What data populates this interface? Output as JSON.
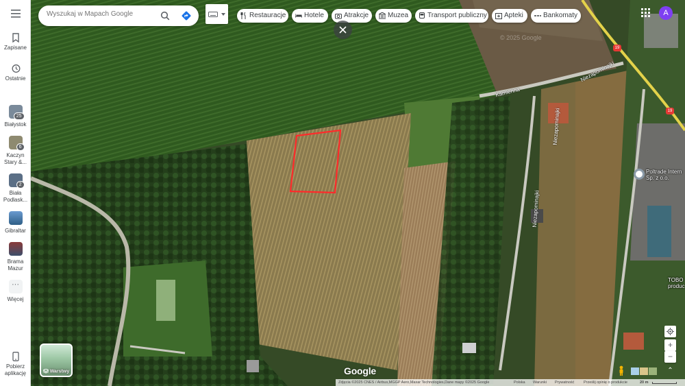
{
  "rail": {
    "saved_label": "Zapisane",
    "recent_label": "Ostatnie",
    "recent_items": [
      {
        "label": "Białystok",
        "badge": "25"
      },
      {
        "label": "Kaczyn Stary &...",
        "badge": "6"
      },
      {
        "label": "Biała Podlask...",
        "badge": "2"
      },
      {
        "label": "Gibraltar",
        "badge": ""
      },
      {
        "label": "Brama Mazur",
        "badge": ""
      }
    ],
    "more_label": "Więcej",
    "download_label": "Pobierz aplikację"
  },
  "search": {
    "placeholder": "Wyszukaj w Mapach Google"
  },
  "chips": [
    {
      "label": "Restauracje",
      "icon": "fork-knife-icon"
    },
    {
      "label": "Hotele",
      "icon": "bed-icon"
    },
    {
      "label": "Atrakcje",
      "icon": "camera-icon"
    },
    {
      "label": "Muzea",
      "icon": "museum-icon"
    },
    {
      "label": "Transport publiczny",
      "icon": "bus-icon"
    },
    {
      "label": "Apteki",
      "icon": "pharmacy-icon"
    },
    {
      "label": "Bankomaty",
      "icon": "atm-icon"
    }
  ],
  "user": {
    "avatar_letter": "A",
    "avatar_color": "#7e3ff2"
  },
  "map": {
    "roads": [
      "Kamienna",
      "Niezapominajki",
      "Niezapominajki",
      "Niezapominajki"
    ],
    "route_badge": "19",
    "places": [
      {
        "name": "Poltrade Intern",
        "sub": "Sp. z o.o."
      },
      {
        "name": "TOBO",
        "sub": "produc"
      }
    ],
    "watermark": "© 2025 Google",
    "parcel_color": "#ff2a2a"
  },
  "layers": {
    "label": "Warstwy"
  },
  "logo": "Google",
  "footer": {
    "imagery": "Zdjęcia ©2025 CNES / Airbus,MGGP Aero,Maxar Technologies,Dane mapy ©2025 Google",
    "country": "Polska",
    "terms": "Warunki",
    "privacy": "Prywatność",
    "feedback": "Prześlij opinię o produkcie",
    "scale": "20 m"
  }
}
